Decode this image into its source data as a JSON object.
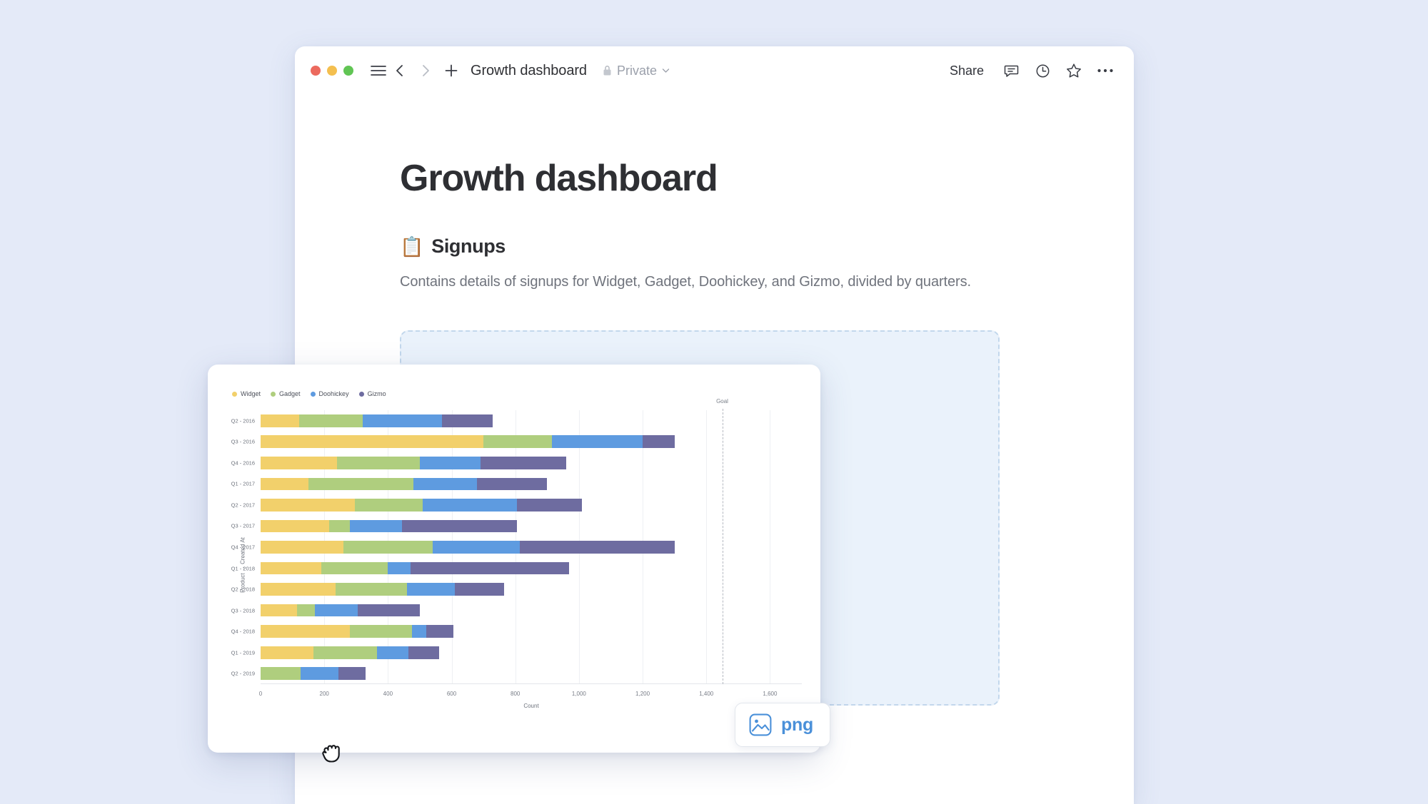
{
  "window": {
    "traffic_lights": [
      "close",
      "minimize",
      "maximize"
    ],
    "menu_icon": "hamburger-icon",
    "back_icon": "chevron-left-icon",
    "forward_icon": "chevron-right-icon",
    "new_icon": "plus-icon",
    "doc_title": "Growth dashboard",
    "privacy_icon": "lock-icon",
    "privacy_label": "Private",
    "privacy_caret": "chevron-down-icon",
    "share_label": "Share",
    "comment_icon": "comment-icon",
    "history_icon": "clock-icon",
    "favorite_icon": "star-icon",
    "more_icon": "ellipsis-icon"
  },
  "document": {
    "title": "Growth dashboard",
    "section_emoji": "📋",
    "section_heading": "Signups",
    "section_description": "Contains details of signups for Widget, Gadget, Doohickey, and Gizmo, divided by quarters."
  },
  "drop_zone": {
    "fill_color": "#eaf2fb",
    "border_color": "#c2d7ec"
  },
  "png_badge": {
    "icon": "image-icon",
    "label": "png",
    "accent_color": "#4a90d9"
  },
  "cursor": {
    "icon": "grabbing-hand-cursor"
  },
  "chart_data": {
    "type": "bar",
    "orientation": "horizontal",
    "stacked": true,
    "title": "",
    "xlabel": "Count",
    "ylabel": "Product → Created At",
    "xlim": [
      0,
      1700
    ],
    "xticks": [
      0,
      200,
      400,
      600,
      800,
      1000,
      1200,
      1400,
      1600
    ],
    "xticklabels": [
      "0",
      "200",
      "400",
      "600",
      "800",
      "1,000",
      "1,200",
      "1,400",
      "1,600"
    ],
    "grid": true,
    "legend_position": "top-left",
    "annotations": [
      {
        "label": "Goal",
        "type": "vline",
        "value": 1450,
        "style": "dashed"
      }
    ],
    "categories": [
      "Q2 - 2016",
      "Q3 - 2016",
      "Q4 - 2016",
      "Q1 - 2017",
      "Q2 - 2017",
      "Q3 - 2017",
      "Q4 - 2017",
      "Q1 - 2018",
      "Q2 - 2018",
      "Q3 - 2018",
      "Q4 - 2018",
      "Q1 - 2019",
      "Q2 - 2019"
    ],
    "series": [
      {
        "name": "Widget",
        "color": "#f2d06b",
        "values": [
          120,
          700,
          240,
          150,
          295,
          215,
          260,
          190,
          235,
          115,
          280,
          165,
          0
        ]
      },
      {
        "name": "Gadget",
        "color": "#afce7e",
        "values": [
          200,
          215,
          260,
          330,
          215,
          65,
          280,
          210,
          225,
          55,
          195,
          200,
          125
        ]
      },
      {
        "name": "Doohickey",
        "color": "#5e9be0",
        "values": [
          250,
          285,
          190,
          200,
          295,
          165,
          275,
          70,
          150,
          135,
          45,
          100,
          120
        ]
      },
      {
        "name": "Gizmo",
        "color": "#6e6ca0",
        "values": [
          160,
          100,
          270,
          220,
          205,
          360,
          485,
          500,
          155,
          195,
          85,
          95,
          85
        ]
      }
    ]
  }
}
